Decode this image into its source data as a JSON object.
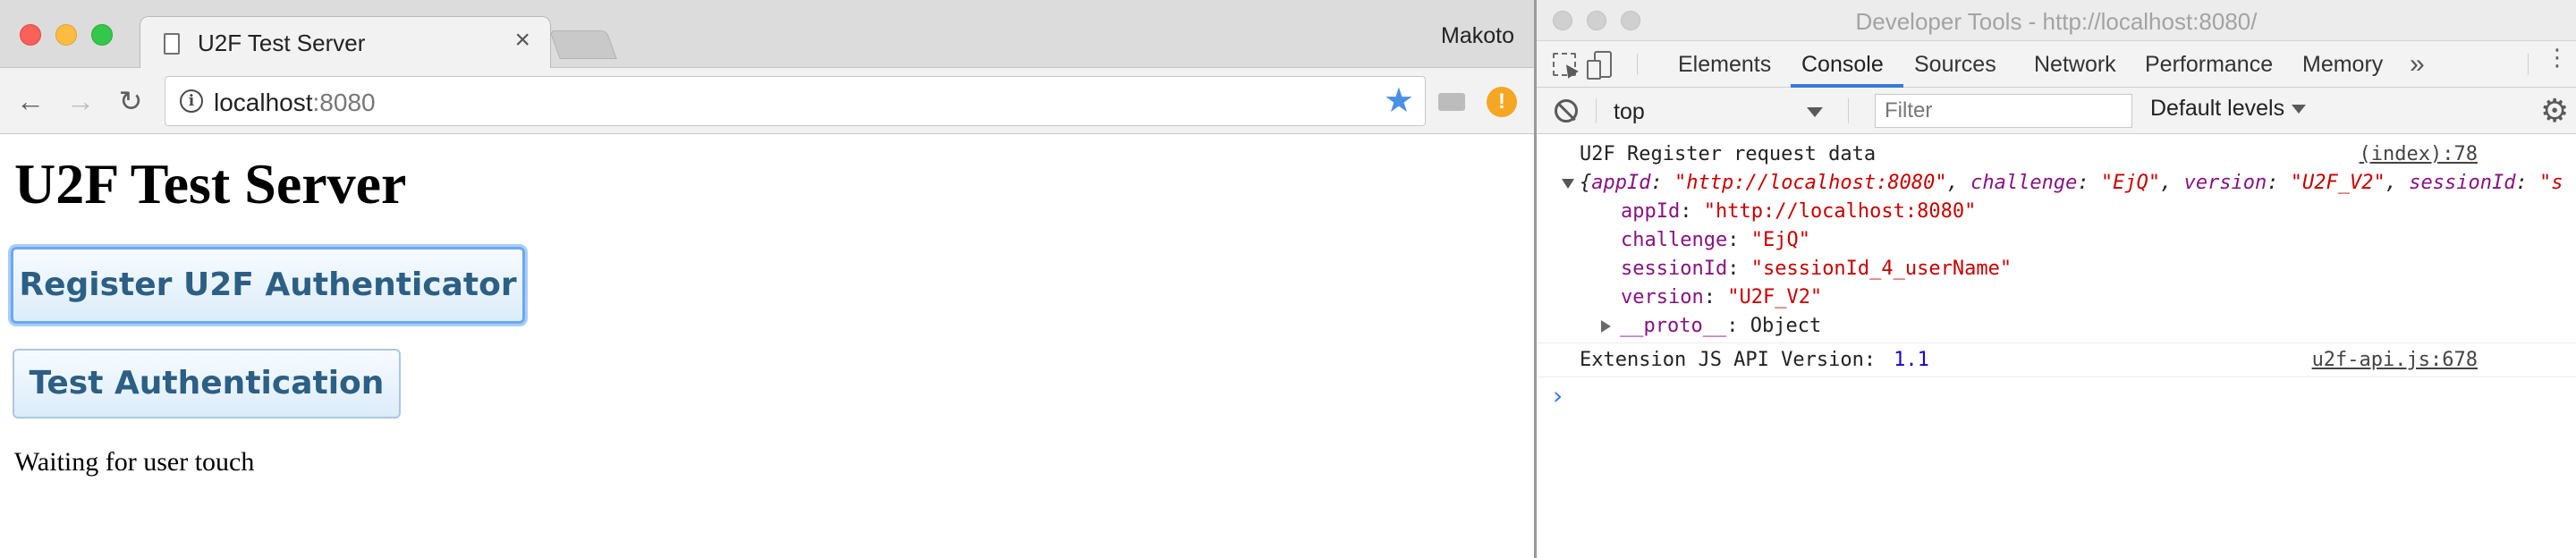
{
  "browser": {
    "tab_title": "U2F Test Server",
    "tab_close": "×",
    "profile_name": "Makoto",
    "url_host": "localhost",
    "url_port": ":8080",
    "info_glyph": "i",
    "star_glyph": "★",
    "alert_glyph": "!",
    "nav": {
      "back": "←",
      "forward": "→",
      "reload": "↻"
    },
    "icons": [
      "document-icon",
      "info-icon",
      "bookmark-star-icon",
      "extension-icon",
      "alert-icon"
    ]
  },
  "page": {
    "title": "U2F Test Server",
    "register_button": "Register U2F Authenticator",
    "test_auth_button": "Test Authentication",
    "status": "Waiting for user touch"
  },
  "devtools": {
    "window_title": "Developer Tools - http://localhost:8080/",
    "tabs": {
      "elements": "Elements",
      "console": "Console",
      "sources": "Sources",
      "network": "Network",
      "performance": "Performance",
      "memory": "Memory",
      "more": "»"
    },
    "menu_glyph": "⋮",
    "context": "top",
    "filter_placeholder": "Filter",
    "levels": "Default levels",
    "settings_glyph": "⚙",
    "prompt_glyph": "›"
  },
  "console": {
    "message1": {
      "text": "U2F Register request data",
      "source": "(index):78",
      "summary_parts": {
        "open": "{",
        "k_appid": "appId",
        "v_appid": "\"http://localhost:8080\"",
        "k_challenge": "challenge",
        "v_challenge": "\"EjQ\"",
        "k_version": "version",
        "v_version": "\"U2F_V2\"",
        "k_session": "sessionId",
        "v_session_trunc": "\"s"
      },
      "properties": {
        "appId_key": "appId",
        "appId_val": "\"http://localhost:8080\"",
        "challenge_key": "challenge",
        "challenge_val": "\"EjQ\"",
        "sessionId_key": "sessionId",
        "sessionId_val": "\"sessionId_4_userName\"",
        "version_key": "version",
        "version_val": "\"U2F_V2\"",
        "proto_key": "__proto__",
        "proto_val": "Object"
      }
    },
    "message2": {
      "text": "Extension JS API Version:",
      "value": "1.1",
      "source": "u2f-api.js:678"
    }
  },
  "colors": {
    "accent": "#3879d9",
    "button_text": "#2c5f84",
    "object_key": "#881280",
    "string_value": "#c80000",
    "number_value": "#1c00cf",
    "warning": "#f5a623"
  }
}
